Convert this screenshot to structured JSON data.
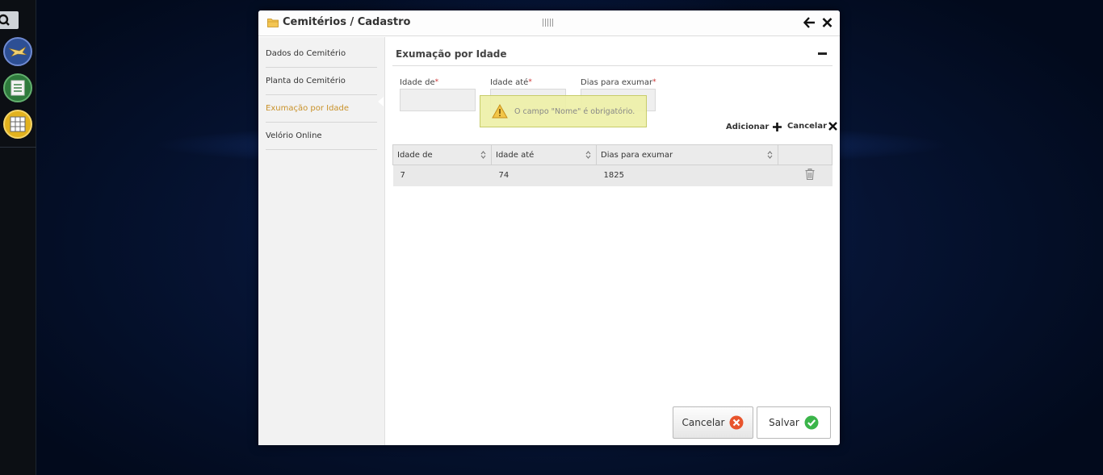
{
  "window": {
    "title": "Cemitérios / Cadastro"
  },
  "nav": {
    "items": [
      {
        "label": "Dados do Cemitério",
        "active": false
      },
      {
        "label": "Planta do Cemitério",
        "active": false
      },
      {
        "label": "Exumação por Idade",
        "active": true
      },
      {
        "label": "Velório Online",
        "active": false
      }
    ]
  },
  "section": {
    "title": "Exumação por Idade"
  },
  "form": {
    "idade_de": {
      "label": "Idade de",
      "value": ""
    },
    "idade_ate": {
      "label": "Idade até",
      "value": ""
    },
    "dias": {
      "label": "Dias para exumar",
      "value": ""
    },
    "required_mark": "*"
  },
  "tooltip": {
    "text": "O campo \"Nome\" é obrigatório."
  },
  "actions": {
    "add_label": "Adicionar",
    "cancel_label": "Cancelar"
  },
  "table": {
    "columns": [
      "Idade de",
      "Idade até",
      "Dias para exumar"
    ],
    "rows": [
      {
        "idade_de": "7",
        "idade_ate": "74",
        "dias": "1825"
      }
    ]
  },
  "footer": {
    "cancel_label": "Cancelar",
    "save_label": "Salvar"
  },
  "colors": {
    "accent_active_nav": "#c9922a",
    "cancel_icon": "#e8542c",
    "save_icon": "#3bb54a",
    "tooltip_bg": "#eef0a8"
  }
}
